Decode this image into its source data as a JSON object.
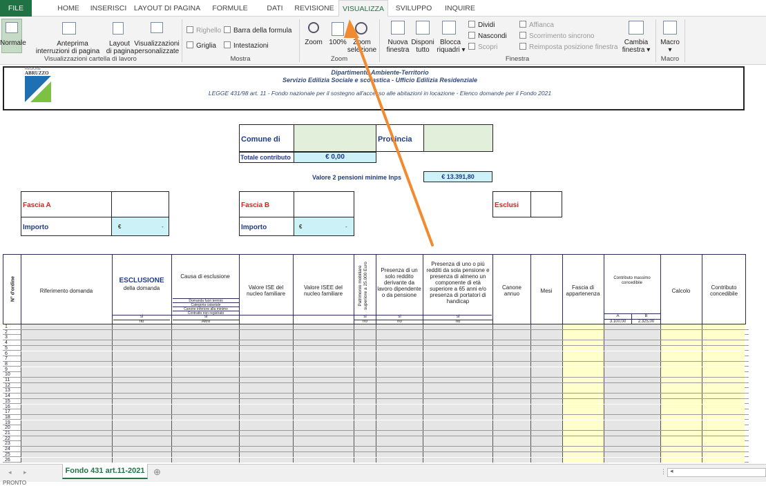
{
  "ribbon_tabs": [
    "FILE",
    "HOME",
    "INSERISCI",
    "LAYOUT DI PAGINA",
    "FORMULE",
    "DATI",
    "REVISIONE",
    "VISUALIZZA",
    "SVILUPPO",
    "INQUIRE"
  ],
  "ribbon": {
    "normale": "Normale",
    "anteprima1": "Anteprima",
    "anteprima2": "interruzioni di pagina",
    "layout1": "Layout",
    "layout2": "di pagina",
    "vis1": "Visualizzazioni",
    "vis2": "personalizzate",
    "righello": "Righello",
    "barra": "Barra della formula",
    "griglia": "Griglia",
    "intestazioni": "Intestazioni",
    "zoom": "Zoom",
    "zoom100": "100%",
    "zoomsel1": "Zoom",
    "zoomsel2": "selezione",
    "nuova1": "Nuova",
    "nuova2": "finestra",
    "disponi1": "Disponi",
    "disponi2": "tutto",
    "blocca1": "Blocca",
    "blocca2": "riquadri ▾",
    "dividi": "Dividi",
    "nascondi": "Nascondi",
    "scopri": "Scopri",
    "affianca": "Affianca",
    "scorrimento": "Scorrimento sincrono",
    "reimposta": "Reimposta posizione finestra",
    "cambia1": "Cambia",
    "cambia2": "finestra ▾",
    "macro1": "Macro",
    "macro2": "▾",
    "g_vis": "Visualizzazioni cartella di lavoro",
    "g_mostra": "Mostra",
    "g_zoom": "Zoom",
    "g_finestra": "Finestra",
    "g_macro": "Macro"
  },
  "sheet": {
    "logo_text1": "REGIONE",
    "logo_text2": "ABRUZZO",
    "title1": "Dipartimento Ambiente-Territorio",
    "title2": "Servizio Edilizia Sociale e scolastica - Ufficio Edilizia Residenziale",
    "title3": "LEGGE 431/98 art. 11 - Fondo nazionale per il sostegno all'accesso alle abitazioni in locazione - Elenco domande per il Fondo 2021",
    "comune": "Comune di",
    "provincia": "Provincia",
    "totale": "Totale contributo",
    "totale_val": "€ 0,00",
    "valore_label": "Valore 2 pensioni minime Inps",
    "valore_val": "€ 13.391,80",
    "fascia_a": "Fascia A",
    "fascia_b": "Fascia B",
    "esclusi": "Esclusi",
    "importo": "Importo",
    "importo_val": "€",
    "importo_dash": "-",
    "h_ordine": "N° d'ordine",
    "h_rif": "Riferimento domanda",
    "h_escl1": "ESCLUSIONE",
    "h_escl2": "della domanda",
    "h_causa": "Causa di esclusione",
    "h_causa_items": [
      "Domanda fuori termini",
      "Categoria catastale",
      "Canone inferiore alla minimo",
      "Contratto non registrato"
    ],
    "h_si": "si",
    "h_no": "no",
    "h_altro": "Altro",
    "h_ise": "Valore ISE del nucleo familiare",
    "h_isee": "Valore ISEE del nucleo familiare",
    "h_patr": "Patrimonio mobiliare superiore a 25.000 Euro",
    "h_reddito": "Presenza di un solo reddito derivante da lavoro dipendente o da pensione",
    "h_pensione": "Presenza di uno o più redditi da sola pensione e presenza di almeno un componente di età superiore a 65 anni e/o presenza di portatori di handicap",
    "h_canone": "Canone annuo",
    "h_mesi": "Mesi",
    "h_fascia": "Fascia di appartenenza",
    "h_contrib": "Contributo massimo concedibile",
    "h_a": "A",
    "h_b": "B",
    "h_aval": "3.100,00",
    "h_bval": "2.325,00",
    "h_calcolo": "Calcolo",
    "h_concedibile": "Contributo concedibile"
  },
  "sheet_tab": "Fondo 431 art.11-2021",
  "add_sheet": "⊕",
  "status_text": "PRONTO"
}
